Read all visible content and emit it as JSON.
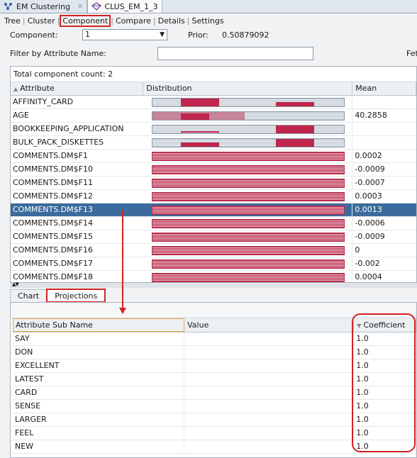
{
  "doc_tabs": [
    {
      "label": "EM Clustering",
      "icon": "clustering-icon",
      "active": false
    },
    {
      "label": "CLUS_EM_1_3",
      "icon": "model-icon",
      "active": true
    }
  ],
  "subtabs": [
    "Tree",
    "Cluster",
    "Component",
    "Compare",
    "Details",
    "Settings"
  ],
  "component": {
    "label": "Component:",
    "value": "1",
    "prior_label": "Prior:",
    "prior_value": "0.50879092"
  },
  "filter": {
    "label": "Filter by Attribute Name:",
    "value": "",
    "fetch_label": "Fet"
  },
  "upper_table": {
    "count": "Total component count: 2",
    "headers": [
      "Attribute",
      "Distribution",
      "Mean"
    ],
    "rows": [
      {
        "attr": "AFFINITY_CARD",
        "mean": ""
      },
      {
        "attr": "AGE",
        "mean": "40.2858"
      },
      {
        "attr": "BOOKKEEPING_APPLICATION",
        "mean": ""
      },
      {
        "attr": "BULK_PACK_DISKETTES",
        "mean": ""
      },
      {
        "attr": "COMMENTS.DM$F1",
        "mean": "0.0002"
      },
      {
        "attr": "COMMENTS.DM$F10",
        "mean": "-0.0009"
      },
      {
        "attr": "COMMENTS.DM$F11",
        "mean": "-0.0007"
      },
      {
        "attr": "COMMENTS.DM$F12",
        "mean": "0.0003"
      },
      {
        "attr": "COMMENTS.DM$F13",
        "mean": "0.0013"
      },
      {
        "attr": "COMMENTS.DM$F14",
        "mean": "-0.0006"
      },
      {
        "attr": "COMMENTS.DM$F15",
        "mean": "-0.0009"
      },
      {
        "attr": "COMMENTS.DM$F16",
        "mean": "0"
      },
      {
        "attr": "COMMENTS.DM$F17",
        "mean": "-0.002"
      },
      {
        "attr": "COMMENTS.DM$F18",
        "mean": "0.0004"
      }
    ]
  },
  "lower_tabs": [
    "Chart",
    "Projections"
  ],
  "lower_table": {
    "headers": [
      "Attribute Sub Name",
      "Value",
      "Coefficient"
    ],
    "rows": [
      {
        "name": "SAY",
        "value": "",
        "coef": "1.0"
      },
      {
        "name": "DON",
        "value": "",
        "coef": "1.0"
      },
      {
        "name": "EXCELLENT",
        "value": "",
        "coef": "1.0"
      },
      {
        "name": "LATEST",
        "value": "",
        "coef": "1.0"
      },
      {
        "name": "CARD",
        "value": "",
        "coef": "1.0"
      },
      {
        "name": "SENSE",
        "value": "",
        "coef": "1.0"
      },
      {
        "name": "LARGER",
        "value": "",
        "coef": "1.0"
      },
      {
        "name": "FEEL",
        "value": "",
        "coef": "1.0"
      },
      {
        "name": "NEW",
        "value": "",
        "coef": "1.0"
      }
    ]
  },
  "colors": {
    "highlight": "#d32222",
    "selection": "#3b6b9c",
    "bar": "#c0254d"
  }
}
